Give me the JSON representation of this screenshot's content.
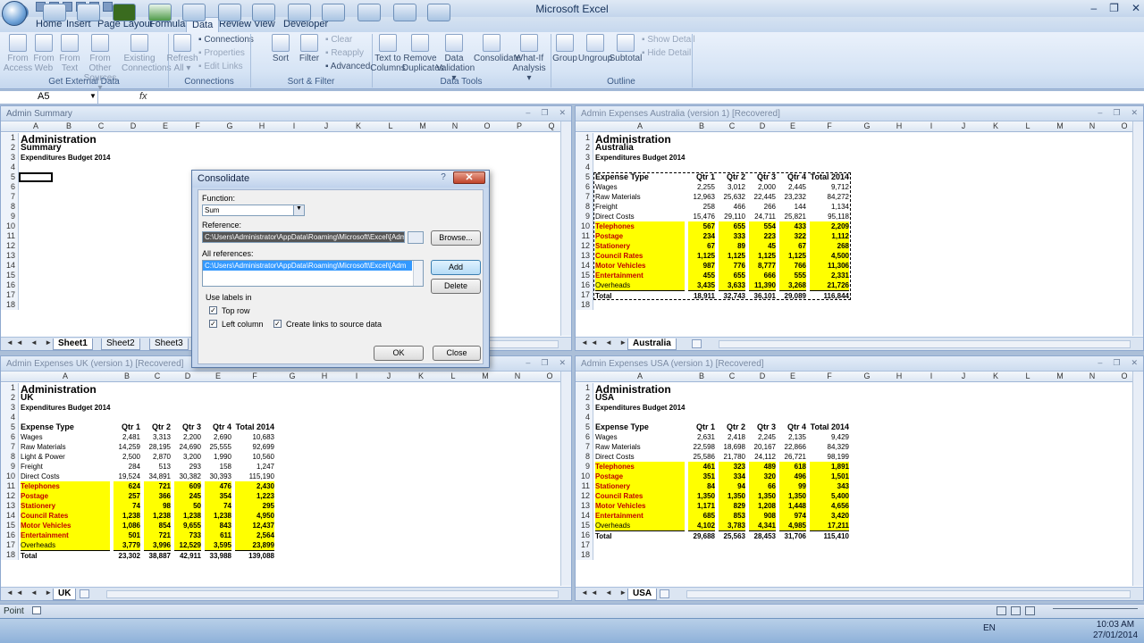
{
  "app": {
    "title": "Microsoft Excel",
    "name_box": "A5",
    "fx": "fx"
  },
  "tabs": [
    "Home",
    "Insert",
    "Page Layout",
    "Formulas",
    "Data",
    "Review",
    "View",
    "Developer"
  ],
  "active_tab": "Data",
  "ribbon": {
    "get_external": {
      "title": "Get External Data",
      "buttons": [
        [
          "From",
          "Access"
        ],
        [
          "From",
          "Web"
        ],
        [
          "From",
          "Text"
        ],
        [
          "From Other",
          "Sources ▾"
        ],
        [
          "Existing",
          "Connections"
        ]
      ]
    },
    "connections": {
      "title": "Connections",
      "refresh": [
        "Refresh",
        "All ▾"
      ],
      "items": [
        "Connections",
        "Properties",
        "Edit Links"
      ]
    },
    "sort_filter": {
      "title": "Sort & Filter",
      "sort": "Sort",
      "filter": "Filter",
      "items": [
        "Clear",
        "Reapply",
        "Advanced"
      ]
    },
    "data_tools": {
      "title": "Data Tools",
      "buttons": [
        [
          "Text to",
          "Columns"
        ],
        [
          "Remove",
          "Duplicates"
        ],
        [
          "Data",
          "Validation ▾"
        ],
        [
          "Consolidate",
          ""
        ],
        [
          "What-If",
          "Analysis ▾"
        ]
      ]
    },
    "outline": {
      "title": "Outline",
      "buttons": [
        [
          "Group",
          ""
        ],
        [
          "Ungroup",
          ""
        ],
        [
          "Subtotal",
          ""
        ]
      ],
      "items": [
        "Show Detail",
        "Hide Detail"
      ]
    }
  },
  "windows": {
    "summary": {
      "title": "Admin Summary",
      "cols": [
        "A",
        "B",
        "C",
        "D",
        "E",
        "F",
        "G",
        "H",
        "I",
        "J",
        "K",
        "L",
        "M",
        "N",
        "O",
        "P",
        "Q"
      ],
      "lines": [
        "Administration",
        "Summary",
        "Expenditures Budget 2014"
      ],
      "sheets": [
        "Sheet1",
        "Sheet2",
        "Sheet3"
      ]
    },
    "australia": {
      "title": "Admin Expenses Australia (version 1) [Recovered]",
      "cols": [
        "A",
        "B",
        "C",
        "D",
        "E",
        "F",
        "G",
        "H",
        "I",
        "J",
        "K",
        "L",
        "M",
        "N",
        "O"
      ],
      "heading": "Administration",
      "region": "Australia",
      "subtitle": "Expenditures Budget 2014",
      "header": [
        "Expense Type",
        "Qtr 1",
        "Qtr 2",
        "Qtr 3",
        "Qtr 4",
        "Total 2014"
      ],
      "rows": [
        [
          "Wages",
          "2,255",
          "3,012",
          "2,000",
          "2,445",
          "9,712"
        ],
        [
          "Raw Materials",
          "12,963",
          "25,632",
          "22,445",
          "23,232",
          "84,272"
        ],
        [
          "Freight",
          "258",
          "466",
          "266",
          "144",
          "1,134"
        ],
        [
          "Direct Costs",
          "15,476",
          "29,110",
          "24,711",
          "25,821",
          "95,118"
        ],
        [
          "Telephones",
          "567",
          "655",
          "554",
          "433",
          "2,209"
        ],
        [
          "Postage",
          "234",
          "333",
          "223",
          "322",
          "1,112"
        ],
        [
          "Stationery",
          "67",
          "89",
          "45",
          "67",
          "268"
        ],
        [
          "Council Rates",
          "1,125",
          "1,125",
          "1,125",
          "1,125",
          "4,500"
        ],
        [
          "Motor Vehicles",
          "987",
          "776",
          "8,777",
          "766",
          "11,306"
        ],
        [
          "Entertainment",
          "455",
          "655",
          "666",
          "555",
          "2,331"
        ],
        [
          "Overheads",
          "3,435",
          "3,633",
          "11,390",
          "3,268",
          "21,726"
        ],
        [
          "Total",
          "18,911",
          "32,743",
          "36,101",
          "29,089",
          "116,844"
        ]
      ],
      "sheet": "Australia"
    },
    "uk": {
      "title": "Admin Expenses UK (version 1) [Recovered]",
      "cols": [
        "A",
        "B",
        "C",
        "D",
        "E",
        "F",
        "G",
        "H",
        "I",
        "J",
        "K",
        "L",
        "M",
        "N",
        "O"
      ],
      "heading": "Administration",
      "region": "UK",
      "subtitle": "Expenditures Budget 2014",
      "header": [
        "Expense Type",
        "Qtr 1",
        "Qtr 2",
        "Qtr 3",
        "Qtr 4",
        "Total 2014"
      ],
      "rows": [
        [
          "Wages",
          "2,481",
          "3,313",
          "2,200",
          "2,690",
          "10,683"
        ],
        [
          "Raw Materials",
          "14,259",
          "28,195",
          "24,690",
          "25,555",
          "92,699"
        ],
        [
          "Light & Power",
          "2,500",
          "2,870",
          "3,200",
          "1,990",
          "10,560"
        ],
        [
          "Freight",
          "284",
          "513",
          "293",
          "158",
          "1,247"
        ],
        [
          "Direct Costs",
          "19,524",
          "34,891",
          "30,382",
          "30,393",
          "115,190"
        ],
        [
          "Telephones",
          "624",
          "721",
          "609",
          "476",
          "2,430"
        ],
        [
          "Postage",
          "257",
          "366",
          "245",
          "354",
          "1,223"
        ],
        [
          "Stationery",
          "74",
          "98",
          "50",
          "74",
          "295"
        ],
        [
          "Council Rates",
          "1,238",
          "1,238",
          "1,238",
          "1,238",
          "4,950"
        ],
        [
          "Motor Vehicles",
          "1,086",
          "854",
          "9,655",
          "843",
          "12,437"
        ],
        [
          "Entertainment",
          "501",
          "721",
          "733",
          "611",
          "2,564"
        ],
        [
          "Overheads",
          "3,779",
          "3,996",
          "12,529",
          "3,595",
          "23,899"
        ],
        [
          "Total",
          "23,302",
          "38,887",
          "42,911",
          "33,988",
          "139,088"
        ]
      ],
      "sheet": "UK"
    },
    "usa": {
      "title": "Admin Expenses USA (version 1) [Recovered]",
      "cols": [
        "A",
        "B",
        "C",
        "D",
        "E",
        "F",
        "G",
        "H",
        "I",
        "J",
        "K",
        "L",
        "M",
        "N",
        "O"
      ],
      "heading": "Administration",
      "region": "USA",
      "subtitle": "Expenditures Budget 2014",
      "header": [
        "Expense Type",
        "Qtr 1",
        "Qtr 2",
        "Qtr 3",
        "Qtr 4",
        "Total 2014"
      ],
      "rows": [
        [
          "Wages",
          "2,631",
          "2,418",
          "2,245",
          "2,135",
          "9,429"
        ],
        [
          "Raw Materials",
          "22,598",
          "18,698",
          "20,167",
          "22,866",
          "84,329"
        ],
        [
          "Direct Costs",
          "25,586",
          "21,780",
          "24,112",
          "26,721",
          "98,199"
        ],
        [
          "Telephones",
          "461",
          "323",
          "489",
          "618",
          "1,891"
        ],
        [
          "Postage",
          "351",
          "334",
          "320",
          "496",
          "1,501"
        ],
        [
          "Stationery",
          "84",
          "94",
          "66",
          "99",
          "343"
        ],
        [
          "Council Rates",
          "1,350",
          "1,350",
          "1,350",
          "1,350",
          "5,400"
        ],
        [
          "Motor Vehicles",
          "1,171",
          "829",
          "1,208",
          "1,448",
          "4,656"
        ],
        [
          "Entertainment",
          "685",
          "853",
          "908",
          "974",
          "3,420"
        ],
        [
          "Overheads",
          "4,102",
          "3,783",
          "4,341",
          "4,985",
          "17,211"
        ],
        [
          "Total",
          "29,688",
          "25,563",
          "28,453",
          "31,706",
          "115,410"
        ]
      ],
      "sheet": "USA"
    }
  },
  "dialog": {
    "title": "Consolidate",
    "function_label": "Function:",
    "function_value": "Sum",
    "reference_label": "Reference:",
    "reference_value": "C:\\Users\\Administrator\\AppData\\Roaming\\Microsoft\\Excel\\[Adm",
    "browse": "Browse...",
    "all_refs_label": "All references:",
    "all_refs_value": "C:\\Users\\Administrator\\AppData\\Roaming\\Microsoft\\Excel\\[Adm",
    "add": "Add",
    "delete": "Delete",
    "use_labels": "Use labels in",
    "top_row": "Top row",
    "left_column": "Left column",
    "create_links": "Create links to source data",
    "ok": "OK",
    "close": "Close"
  },
  "status": {
    "mode": "Point"
  },
  "tray": {
    "lang": "EN",
    "time": "10:03 AM",
    "date": "27/01/2014"
  }
}
